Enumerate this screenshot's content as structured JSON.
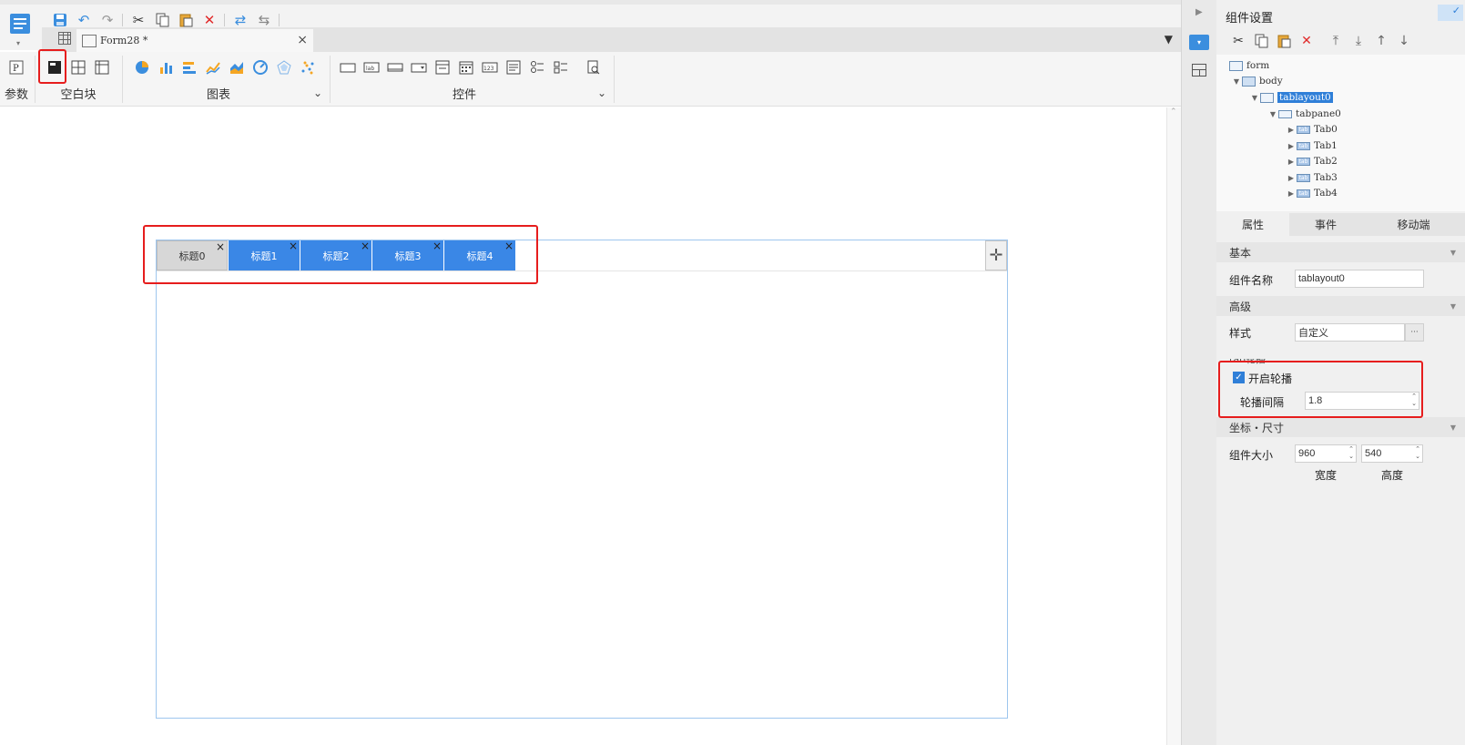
{
  "toolbar": {
    "quick_icons": [
      "save-icon",
      "undo-icon",
      "redo-icon",
      "cut-icon",
      "copy-icon",
      "paste-icon",
      "delete-icon",
      "swap-icon",
      "exchange-icon"
    ]
  },
  "document_tab": {
    "label": "Form28 *",
    "close": "×"
  },
  "ribbon": {
    "param_label": "参数",
    "blank_label": "空白块",
    "chart_label": "图表",
    "control_label": "控件",
    "dropdown_glyph": "⌄"
  },
  "tab_layout": {
    "tabs": [
      {
        "label": "标题0",
        "state": "active"
      },
      {
        "label": "标题1",
        "state": "inactive"
      },
      {
        "label": "标题2",
        "state": "inactive"
      },
      {
        "label": "标题3",
        "state": "inactive"
      },
      {
        "label": "标题4",
        "state": "inactive"
      }
    ],
    "close_glyph": "×",
    "add_glyph": "✛",
    "colors": {
      "active": "#d7d7d7",
      "inactive": "#3a87e6",
      "border": "#9ec6ee"
    }
  },
  "panel": {
    "title": "组件设置",
    "tree": {
      "form": "form",
      "body": "body",
      "tablayout": "tablayout0",
      "tabpane": "tabpane0",
      "tabs": [
        "Tab0",
        "Tab1",
        "Tab2",
        "Tab3",
        "Tab4"
      ],
      "tab_icon_text": "tab"
    },
    "tabs": {
      "properties": "属性",
      "events": "事件",
      "mobile": "移动端"
    },
    "sections": {
      "basic": "基本",
      "advanced": "高级",
      "carousel": "tab轮播",
      "position_size": "坐标・尺寸"
    },
    "fields": {
      "component_name_label": "组件名称",
      "component_name_value": "tablayout0",
      "style_label": "样式",
      "style_value": "自定义",
      "style_more": "···",
      "carousel_enable_label": "开启轮播",
      "carousel_enabled": true,
      "carousel_interval_label": "轮播间隔",
      "carousel_interval_value": "1.8",
      "size_label": "组件大小",
      "width_value": "960",
      "height_value": "540",
      "width_caption": "宽度",
      "height_caption": "高度"
    }
  },
  "highlight_color": "#e61d1d"
}
